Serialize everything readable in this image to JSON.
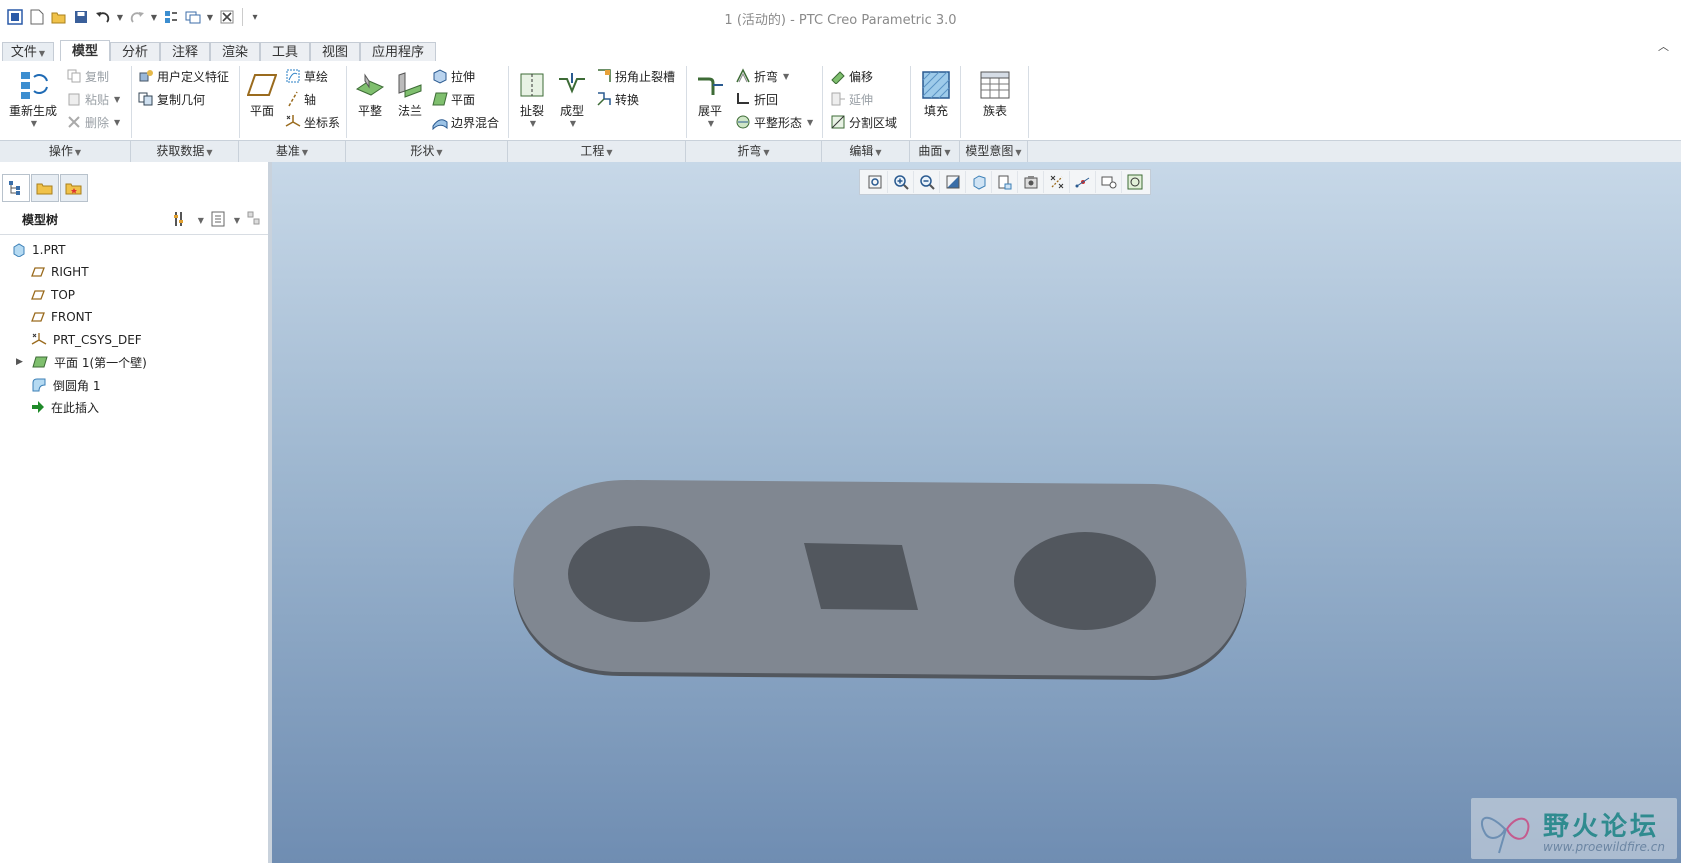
{
  "window": {
    "title": "1 (活动的) - PTC Creo Parametric 3.0"
  },
  "tabs": [
    "文件",
    "模型",
    "分析",
    "注释",
    "渲染",
    "工具",
    "视图",
    "应用程序"
  ],
  "ribbon": {
    "operations": {
      "regenerate": "重新生成",
      "copy": "复制",
      "paste": "粘贴",
      "delete": "删除"
    },
    "get_data": {
      "udf": "用户定义特征",
      "copy_geom": "复制几何"
    },
    "datum": {
      "plane": "平面",
      "sketch": "草绘",
      "axis": "轴",
      "csys": "坐标系"
    },
    "shapes": {
      "flat": "平整",
      "flange": "法兰",
      "extrude": "拉伸",
      "planar": "平面",
      "blend": "边界混合"
    },
    "engineering": {
      "rip": "扯裂",
      "form": "成型",
      "corner_relief": "拐角止裂槽",
      "convert": "转换"
    },
    "bends": {
      "unbend": "展平",
      "bend": "折弯",
      "bend_back": "折回",
      "flat_state": "平整形态"
    },
    "editing": {
      "offset": "偏移",
      "extend": "延伸",
      "split": "分割区域"
    },
    "surfaces": {
      "fill": "填充"
    },
    "model_intent": {
      "family_table": "族表"
    }
  },
  "group_labels": [
    "操作",
    "获取数据",
    "基准",
    "形状",
    "工程",
    "折弯",
    "编辑",
    "曲面",
    "模型意图"
  ],
  "model_tree": {
    "title": "模型树",
    "items": [
      {
        "label": "1.PRT",
        "icon": "part-icon"
      },
      {
        "label": "RIGHT",
        "icon": "datum-plane-icon"
      },
      {
        "label": "TOP",
        "icon": "datum-plane-icon"
      },
      {
        "label": "FRONT",
        "icon": "datum-plane-icon"
      },
      {
        "label": "PRT_CSYS_DEF",
        "icon": "csys-icon"
      },
      {
        "label": "平面 1(第一个壁)",
        "icon": "planar-wall-icon"
      },
      {
        "label": "倒圆角 1",
        "icon": "round-icon"
      },
      {
        "label": "在此插入",
        "icon": "insert-here-icon"
      }
    ]
  },
  "watermark": {
    "name": "野火论坛",
    "url": "www.proewildfire.cn"
  },
  "colors": {
    "viewport_top": "#c7d8e8",
    "viewport_bottom": "#6f8db2",
    "part_fill": "#808791",
    "accent": "#2f8b8f"
  }
}
